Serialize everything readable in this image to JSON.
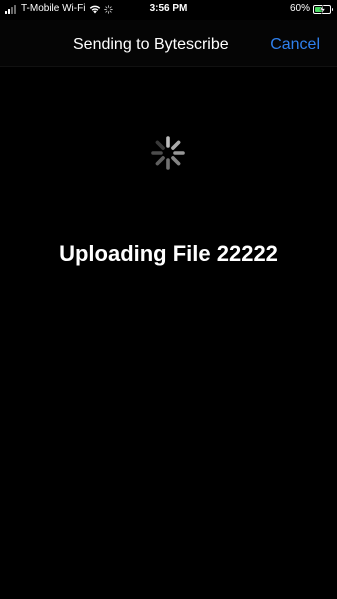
{
  "status_bar": {
    "carrier": "T-Mobile Wi-Fi",
    "time": "3:56 PM",
    "battery_percent": "60%",
    "battery_level": 0.6,
    "battery_charging": true,
    "icons": [
      "cellular-signal-icon",
      "wifi-icon",
      "activity-spinner-icon",
      "battery-icon",
      "charging-bolt-icon"
    ],
    "signal_bars_active": 2,
    "signal_bars_total": 4
  },
  "nav_bar": {
    "title": "Sending to Bytescribe",
    "cancel_label": "Cancel"
  },
  "content": {
    "spinner_icon": "loading-spinner-icon",
    "message": "Uploading File 22222"
  },
  "colors": {
    "background": "#000000",
    "text": "#ffffff",
    "accent": "#2f80ed",
    "battery_fill": "#4cd964",
    "spinner": "#bdbdbd"
  }
}
